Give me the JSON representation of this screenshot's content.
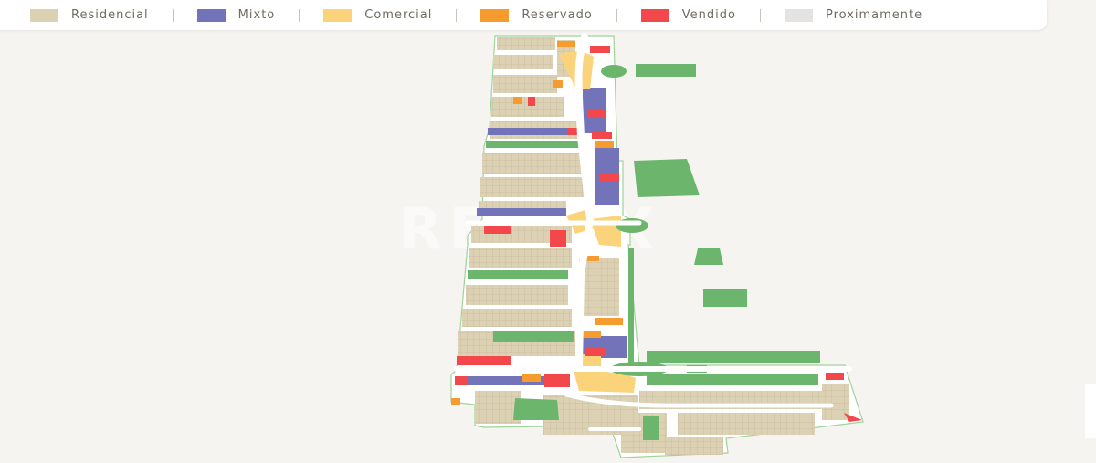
{
  "legend": {
    "items": [
      {
        "key": "residencial",
        "label": "Residencial",
        "color": "#ddd1b4"
      },
      {
        "key": "mixto",
        "label": "Mixto",
        "color": "#7273b9"
      },
      {
        "key": "comercial",
        "label": "Comercial",
        "color": "#fad37b"
      },
      {
        "key": "reservado",
        "label": "Reservado",
        "color": "#f69b2e"
      },
      {
        "key": "vendido",
        "label": "Vendido",
        "color": "#f2484b"
      },
      {
        "key": "proximamente",
        "label": "Proximamente",
        "color": "#e4e3e1"
      }
    ]
  },
  "map": {
    "watermark": "REMAX",
    "colors": {
      "green_area": "#6cb56c",
      "road": "#ffffff",
      "boundary": "#9fd39a",
      "lot_lines": "#c7bb9f"
    }
  }
}
